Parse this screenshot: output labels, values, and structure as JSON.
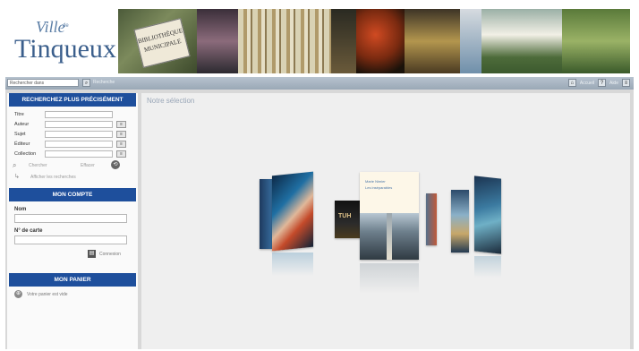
{
  "logo": {
    "line1": "Ville",
    "line1_small": "de",
    "line2": "Tinqueux"
  },
  "banner": {
    "sign_text": "BIBLIOTHÈQUE MUNICIPALE"
  },
  "topbar": {
    "search_placeholder": "Rechercher dans",
    "search_button_label": "OK",
    "search_link": "Recherche",
    "right_links": [
      "Accueil",
      "Aide"
    ]
  },
  "search_panel": {
    "header": "RECHERCHEZ PLUS PRÉCISÉMENT",
    "fields": [
      {
        "label": "Titre",
        "has_index": false
      },
      {
        "label": "Auteur",
        "has_index": true
      },
      {
        "label": "Sujet",
        "has_index": true
      },
      {
        "label": "Éditeur",
        "has_index": true
      },
      {
        "label": "Collection",
        "has_index": true
      }
    ],
    "index_button": "≡",
    "search_label": "Chercher",
    "clear_label": "Effacer",
    "history_label": "Afficher les recherches"
  },
  "account_panel": {
    "header": "MON COMPTE",
    "name_label": "Nom",
    "card_label": "N° de carte",
    "connect_label": "Connexion"
  },
  "cart_panel": {
    "header": "MON PANIER",
    "empty_text": "Votre panier est vide"
  },
  "main": {
    "title": "Notre sélection",
    "featured_book": {
      "author": "Marie Nimier",
      "title": "Les inséparables"
    }
  },
  "colors": {
    "accent": "#1e4f9c",
    "topbar": "#a9b6c3"
  }
}
